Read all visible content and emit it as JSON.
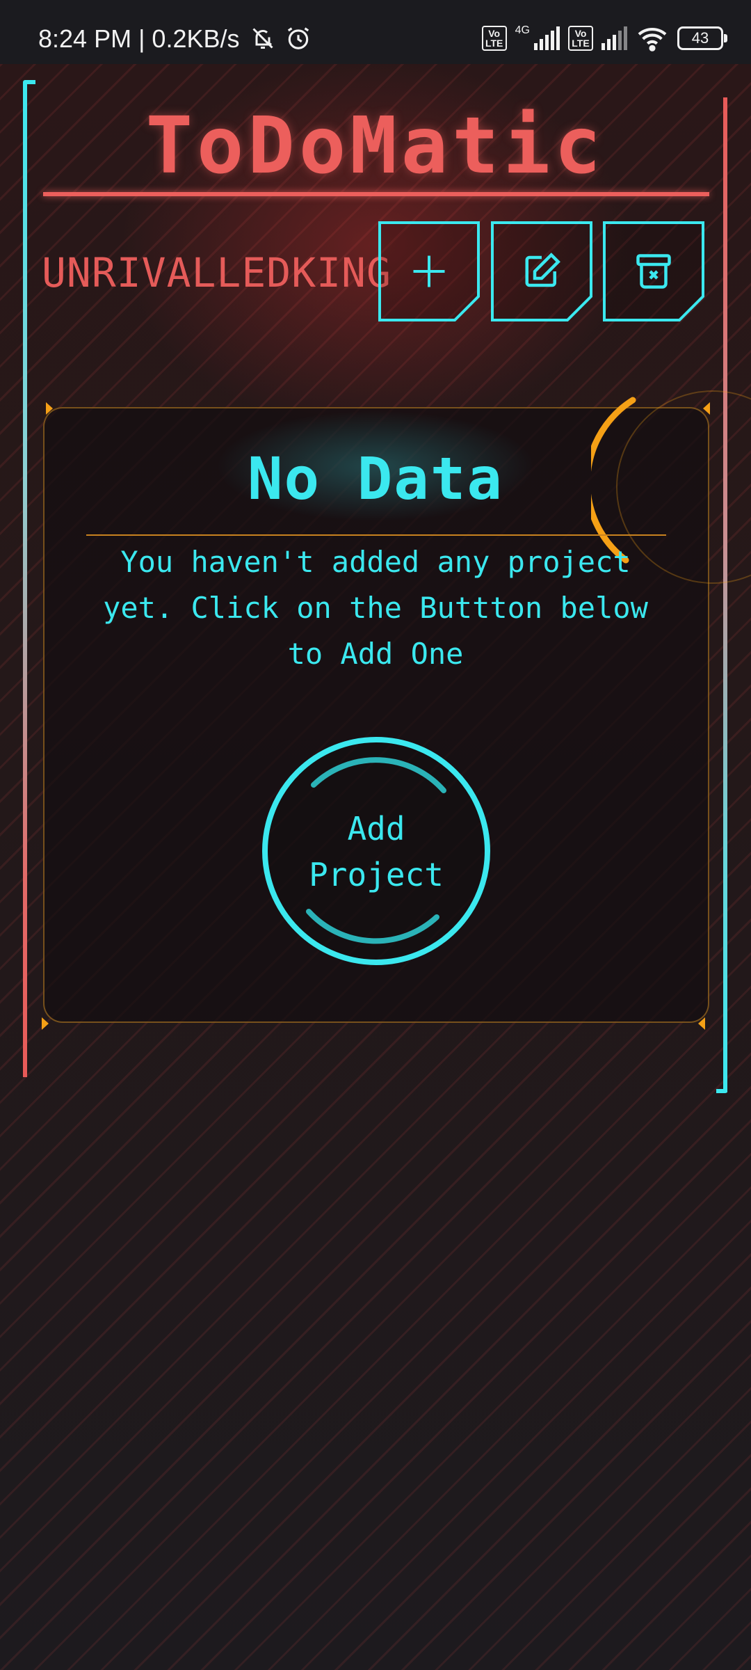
{
  "status_bar": {
    "time_and_speed": "8:24 PM | 0.2KB/s",
    "volte_label": "Vo\nLTE",
    "network_type": "4G",
    "battery_level": "43"
  },
  "app": {
    "title": "ToDoMatic",
    "username": "UNRIVALLEDKING"
  },
  "toolbar": {
    "add_icon": "plus-icon",
    "edit_icon": "pencil-icon",
    "delete_icon": "archive-x-icon"
  },
  "empty_state": {
    "heading": "No Data",
    "message": "You haven't added any project yet. Click on the Buttton below to Add One",
    "button_label": "Add\nProject"
  },
  "colors": {
    "accent_cyan": "#3be8ef",
    "accent_red": "#ec5f5c",
    "accent_orange": "#f5a016"
  }
}
